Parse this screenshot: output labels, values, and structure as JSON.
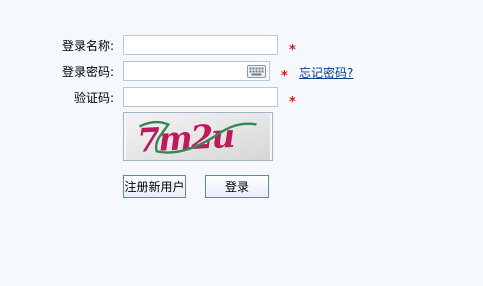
{
  "form": {
    "username_label": "登录名称:",
    "password_label": "登录密码:",
    "captcha_label": "验证码:",
    "username_value": "",
    "password_value": "",
    "captcha_value": "",
    "required_mark": "*",
    "forgot_password_link": "忘记密码?",
    "captcha_image_text": "7m2u",
    "register_button": "注册新用户",
    "login_button": "登录"
  },
  "colors": {
    "background": "#f5f9fd",
    "required": "#e0141e",
    "link": "#0b3f8f",
    "captcha_text": "#c2185b",
    "captcha_line": "#2e8b57"
  }
}
